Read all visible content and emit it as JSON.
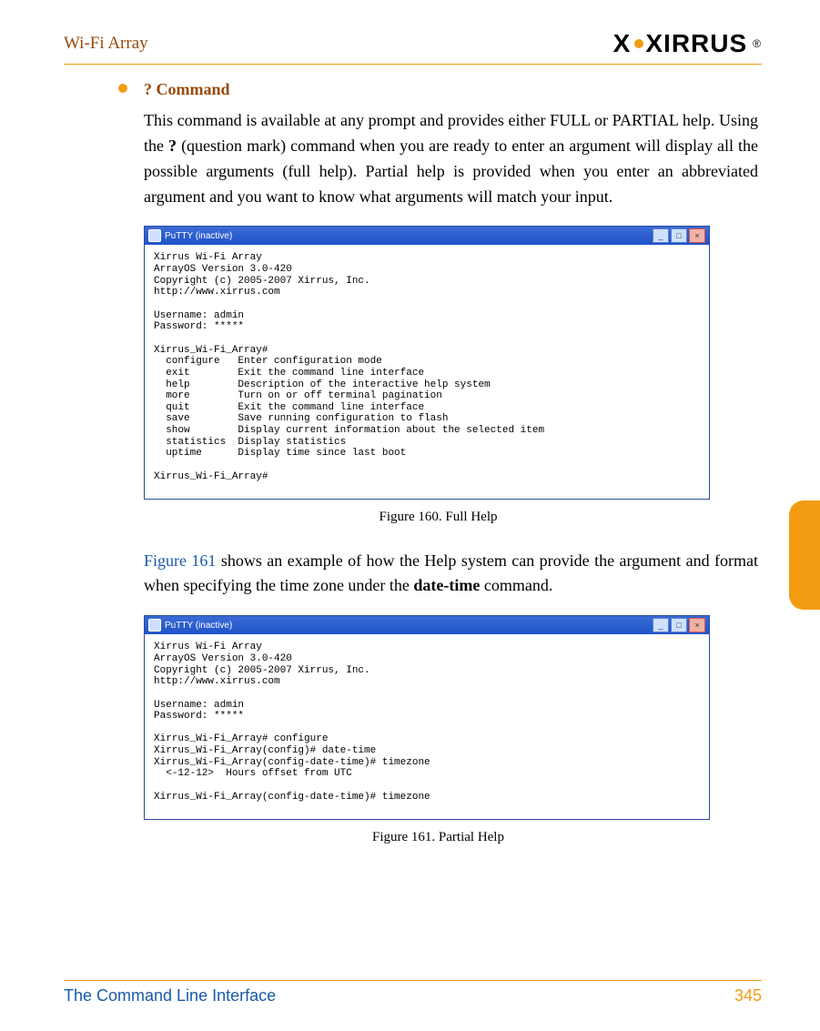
{
  "header": {
    "title": "Wi-Fi Array",
    "brand": "XIRRUS"
  },
  "section": {
    "bullet_title": "? Command",
    "para1_a": "This command is available at any prompt and provides either FULL or PARTIAL help. Using the ",
    "para1_b": "?",
    "para1_c": " (question mark) command when you are ready to enter an argument will display all the possible arguments (full help). Partial help is provided when you enter an abbreviated argument and you want to know what arguments will match your input.",
    "para2_link": "Figure 161",
    "para2_a": "  shows an example of how the Help system can provide the argument and format when specifying the time zone under the ",
    "para2_bold": "date-time",
    "para2_b": " command."
  },
  "fig160": {
    "caption": "Figure 160. Full Help",
    "win_title": "PuTTY (inactive)",
    "text": "Xirrus Wi-Fi Array\nArrayOS Version 3.0-420\nCopyright (c) 2005-2007 Xirrus, Inc.\nhttp://www.xirrus.com\n\nUsername: admin\nPassword: *****\n\nXirrus_Wi-Fi_Array#\n  configure   Enter configuration mode\n  exit        Exit the command line interface\n  help        Description of the interactive help system\n  more        Turn on or off terminal pagination\n  quit        Exit the command line interface\n  save        Save running configuration to flash\n  show        Display current information about the selected item\n  statistics  Display statistics\n  uptime      Display time since last boot\n\nXirrus_Wi-Fi_Array#"
  },
  "fig161": {
    "caption": "Figure 161. Partial Help",
    "win_title": "PuTTY (inactive)",
    "text": "Xirrus Wi-Fi Array\nArrayOS Version 3.0-420\nCopyright (c) 2005-2007 Xirrus, Inc.\nhttp://www.xirrus.com\n\nUsername: admin\nPassword: *****\n\nXirrus_Wi-Fi_Array# configure\nXirrus_Wi-Fi_Array(config)# date-time\nXirrus_Wi-Fi_Array(config-date-time)# timezone\n  <-12-12>  Hours offset from UTC\n\nXirrus_Wi-Fi_Array(config-date-time)# timezone"
  },
  "footer": {
    "left": "The Command Line Interface",
    "right": "345"
  },
  "win_buttons": {
    "min": "_",
    "max": "□",
    "close": "×"
  }
}
